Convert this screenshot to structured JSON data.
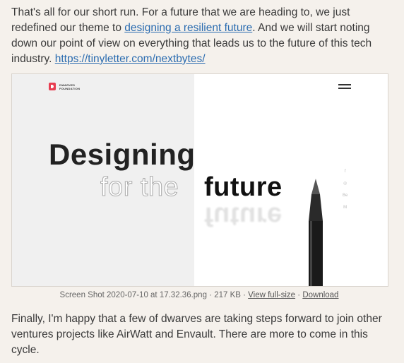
{
  "paragraph1": {
    "text_before": "That's all for our short run. For a future that we are heading to, we just redefined our theme to ",
    "link1": "designing a resilient future",
    "text_middle": ". And we will start noting down our point of view on everything that leads us to the future of this tech industry. ",
    "link2": "https://tinyletter.com/nextbytes/"
  },
  "figure": {
    "logo_line1": "DWARVES",
    "logo_line2": "FOUNDATION",
    "headline1": "Designing",
    "headline2a": "for the",
    "headline2b": "future",
    "socials": [
      "f",
      "◎",
      "Be",
      "M"
    ]
  },
  "caption": {
    "filename": "Screen Shot 2020-07-10 at 17.32.36.png",
    "sep1": " · ",
    "size": "217 KB",
    "sep2": " · ",
    "view_full": "View full-size",
    "sep3": " · ",
    "download": "Download"
  },
  "paragraph2": {
    "text": "Finally, I'm happy that a few of dwarves are taking steps forward to join other ventures projects like AirWatt and Envault. There are more to come in this cycle."
  },
  "colors": {
    "link": "#2b6cb0",
    "background": "#f5f1ec",
    "logo": "#e83e51"
  }
}
